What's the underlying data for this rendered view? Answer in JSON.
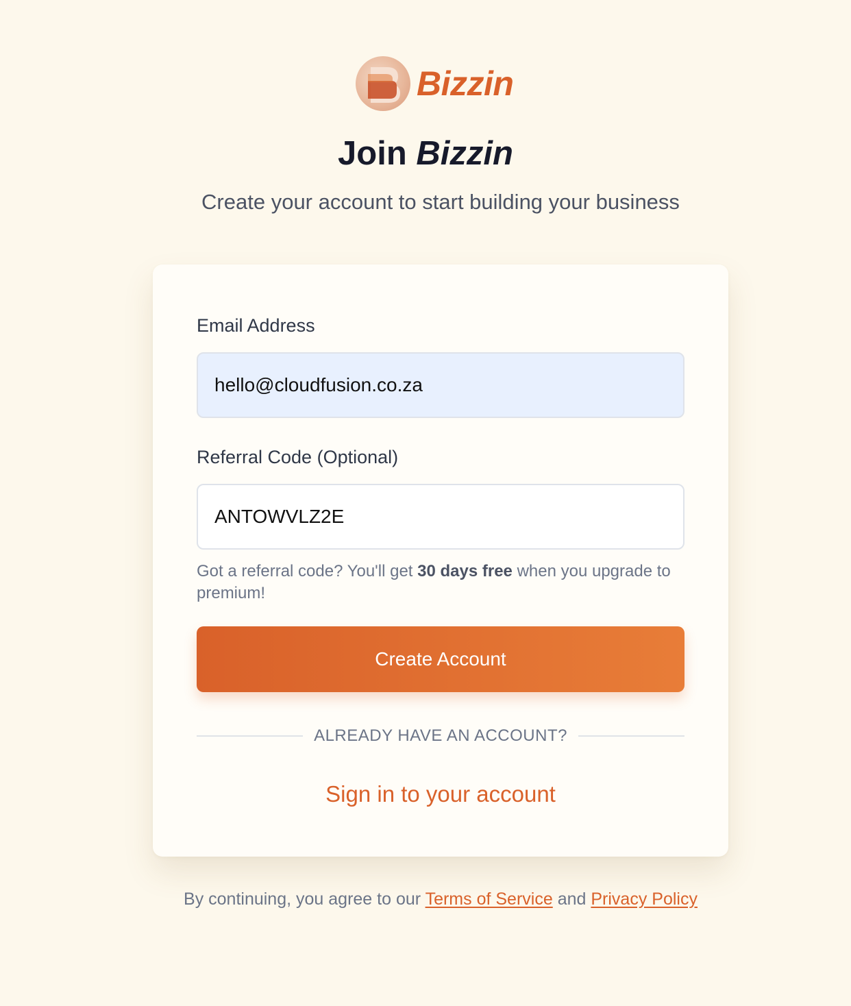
{
  "brand": {
    "name": "Bizzin",
    "accent_color": "#d9612a",
    "logo_icon": "bizzin-b-logo-icon"
  },
  "heading": {
    "prefix": "Join",
    "brand": "Bizzin"
  },
  "subheading": "Create your account to start building your business",
  "form": {
    "email": {
      "label": "Email Address",
      "value": "hello@cloudfusion.co.za"
    },
    "referral": {
      "label": "Referral Code (Optional)",
      "value": "ANTOWVLZ2E"
    },
    "hint": {
      "before": "Got a referral code? You'll get",
      "bold": "30 days free",
      "after": "when you upgrade to premium!"
    },
    "submit_label": "Create Account",
    "divider_text": "ALREADY HAVE AN ACCOUNT?",
    "signin_link": "Sign in to your account"
  },
  "footer": {
    "prefix": "By continuing, you agree to our",
    "terms": "Terms of Service",
    "conjunction": "and",
    "privacy": "Privacy Policy"
  }
}
